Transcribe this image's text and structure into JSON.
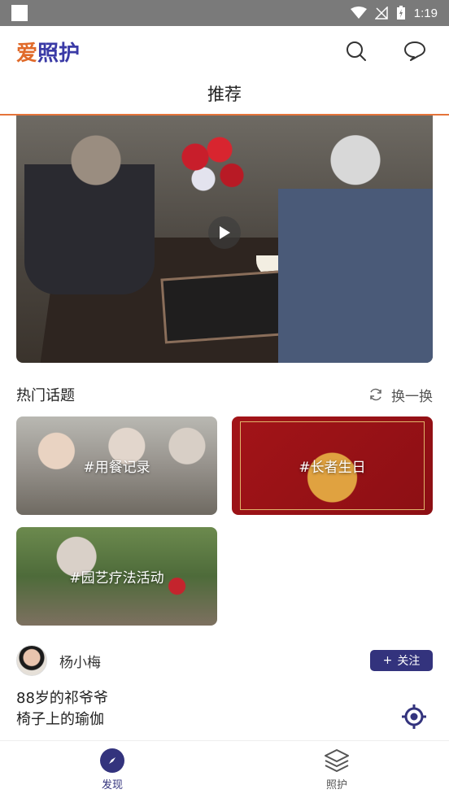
{
  "status_bar": {
    "time": "1:19"
  },
  "app": {
    "logo_left": "爱",
    "logo_right": "照护"
  },
  "header": {
    "tab_label": "推荐"
  },
  "video": {
    "has_play_button": true
  },
  "hot_topics": {
    "title": "热门话题",
    "refresh_label": "换一换",
    "items": [
      {
        "label": "#用餐记录"
      },
      {
        "label": "#长者生日"
      },
      {
        "label": "#园艺疗法活动"
      }
    ]
  },
  "post": {
    "author": "杨小梅",
    "follow_label": "关注",
    "text_line1": "88岁的祁爷爷",
    "text_line2": "椅子上的瑜伽"
  },
  "bottom_nav": [
    {
      "label": "发现",
      "active": true
    },
    {
      "label": "照护",
      "active": false
    }
  ],
  "colors": {
    "primary": "#33337d",
    "accent": "#e5743a"
  }
}
